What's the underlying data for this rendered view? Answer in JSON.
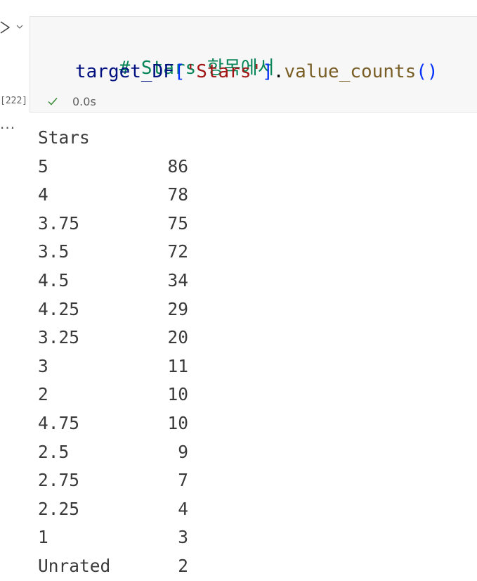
{
  "cell": {
    "code": {
      "line1": "# Stars 항목에서",
      "line2_var": "target_DF",
      "line2_bracket_open": "[",
      "line2_string": "'Stars'",
      "line2_bracket_close": "]",
      "line2_dot": ".",
      "line2_func": "value_counts",
      "line2_parens": "()"
    },
    "execution_count": "[222]",
    "duration": "0.0s",
    "status_icon": "check-icon",
    "run_icon": "run-triangle-icon"
  },
  "output": {
    "menu_label": "···",
    "header": "Stars",
    "rows": [
      {
        "key": "5",
        "value": "86"
      },
      {
        "key": "4",
        "value": "78"
      },
      {
        "key": "3.75",
        "value": "75"
      },
      {
        "key": "3.5",
        "value": "72"
      },
      {
        "key": "4.5",
        "value": "34"
      },
      {
        "key": "4.25",
        "value": "29"
      },
      {
        "key": "3.25",
        "value": "20"
      },
      {
        "key": "3",
        "value": "11"
      },
      {
        "key": "2",
        "value": "10"
      },
      {
        "key": "4.75",
        "value": "10"
      },
      {
        "key": "2.5",
        "value": "9"
      },
      {
        "key": "2.75",
        "value": "7"
      },
      {
        "key": "2.25",
        "value": "4"
      },
      {
        "key": "1",
        "value": "3"
      },
      {
        "key": "Unrated",
        "value": "2"
      }
    ]
  },
  "colors": {
    "comment": "#098658",
    "variable": "#001080",
    "bracket": "#0431fa",
    "string": "#a31515",
    "function": "#795e26",
    "success": "#388a34"
  }
}
